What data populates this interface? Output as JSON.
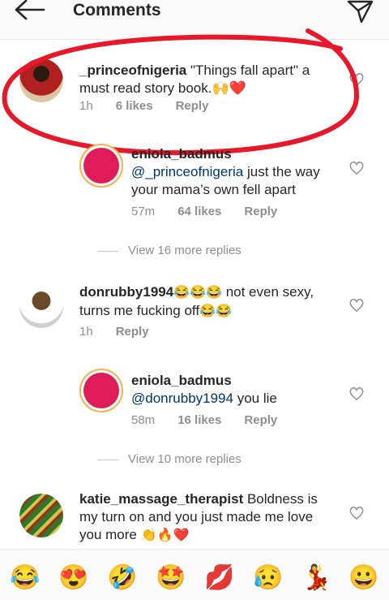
{
  "header": {
    "title": "Comments"
  },
  "comments": [
    {
      "username": "_princeofnigeria",
      "text": " \"Things fall apart\" a must read story book.",
      "emojis": "🙌❤️",
      "time": "1h",
      "likes": "6 likes",
      "reply": "Reply"
    },
    {
      "username": "eniola_badmus",
      "mention": "@_princeofnigeria",
      "text": " just the way your mama’s own fell apart",
      "time": "57m",
      "likes": "64 likes",
      "reply": "Reply"
    },
    {
      "view_more": "View 16 more replies"
    },
    {
      "username": "donrubby1994",
      "emojis_a": "😂😂😂",
      "text": " not even sexy, turns me fucking off",
      "emojis_b": "😂😂",
      "time": "1h",
      "reply": "Reply"
    },
    {
      "username": "eniola_badmus",
      "mention": "@donrubby1994",
      "text": " you lie",
      "time": "58m",
      "likes": "16 likes",
      "reply": "Reply"
    },
    {
      "view_more": "View 10 more replies"
    },
    {
      "username": "katie_massage_therapist",
      "text": " Boldness is my turn on and you just made me love you more ",
      "emojis": "👏🔥❤️"
    }
  ],
  "emoji_bar": [
    "😂",
    "😍",
    "🤣",
    "🤩",
    "💋",
    "😥",
    "💃",
    "😀"
  ],
  "colors": {
    "accent_red": "#e8172a",
    "mention": "#003569",
    "meta_gray": "#8e8e8e"
  }
}
